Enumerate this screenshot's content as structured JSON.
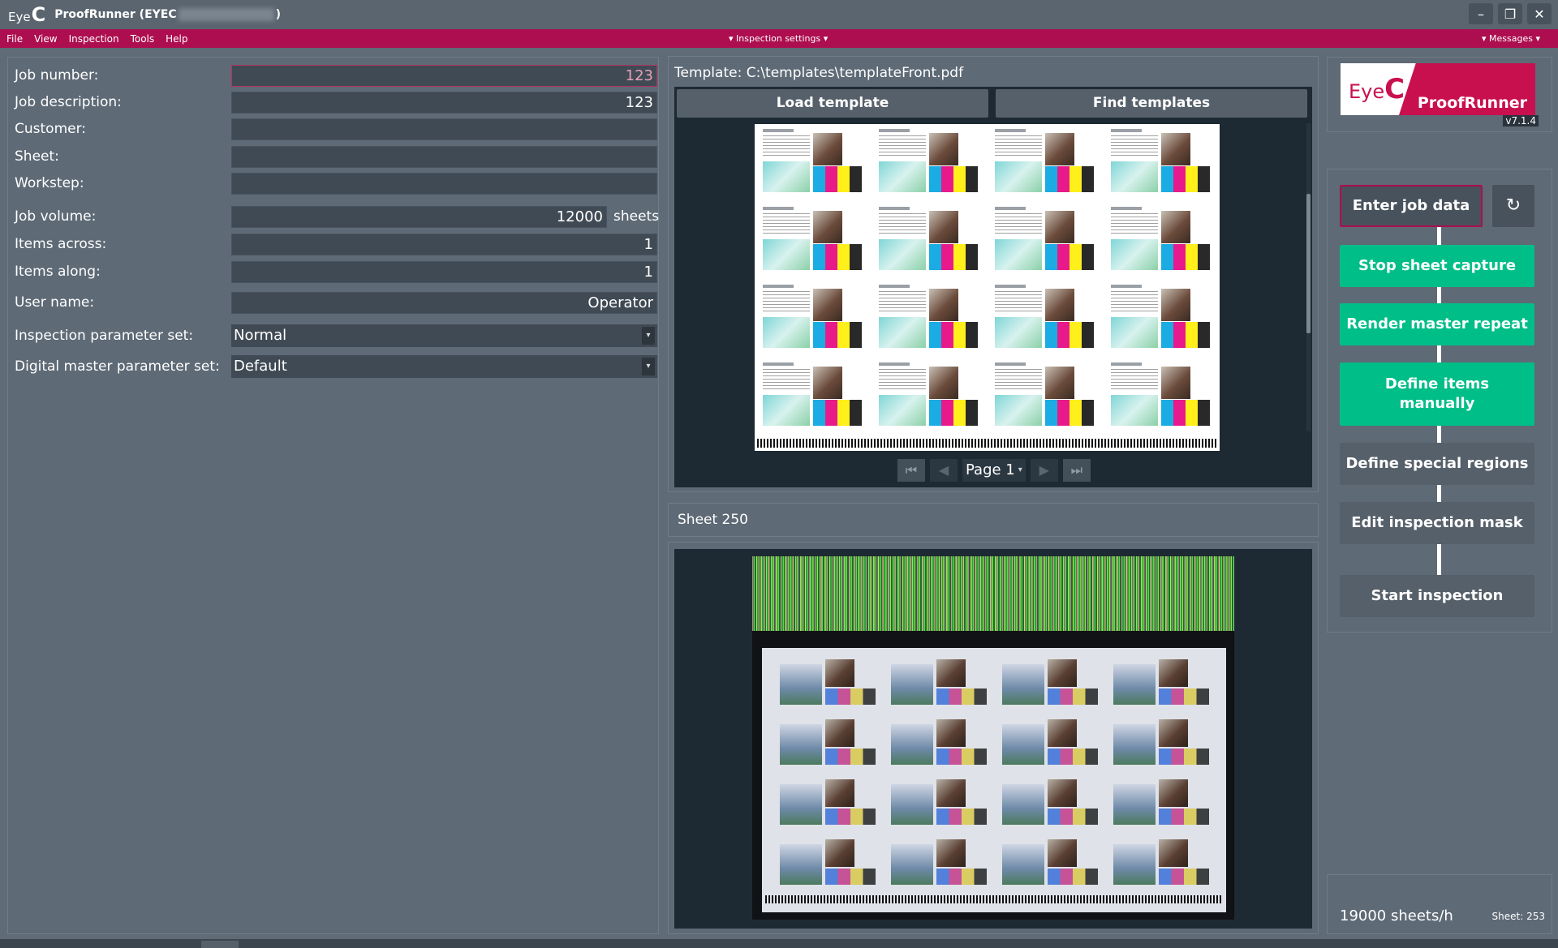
{
  "titlebar": {
    "logo_text": "Eye",
    "logo_c": "C",
    "title_prefix": "ProofRunner  (EYEC",
    "title_suffix": ")",
    "min_icon": "–",
    "restore_icon": "❐",
    "close_icon": "✕"
  },
  "menubar": {
    "items": [
      "File",
      "View",
      "Inspection",
      "Tools",
      "Help"
    ],
    "center": "▾ Inspection settings ▾",
    "right": "▾ Messages ▾"
  },
  "form": {
    "job_number": {
      "label": "Job number:",
      "value": "123"
    },
    "job_description": {
      "label": "Job description:",
      "value": "123"
    },
    "customer": {
      "label": "Customer:",
      "value": ""
    },
    "sheet": {
      "label": "Sheet:",
      "value": ""
    },
    "workstep": {
      "label": "Workstep:",
      "value": ""
    },
    "job_volume": {
      "label": "Job volume:",
      "value": "12000",
      "unit": "sheets"
    },
    "items_across": {
      "label": "Items across:",
      "value": "1"
    },
    "items_along": {
      "label": "Items along:",
      "value": "1"
    },
    "user_name": {
      "label": "User name:",
      "value": "Operator"
    },
    "inspection_param": {
      "label": "Inspection parameter set:",
      "value": "Normal"
    },
    "digital_master_param": {
      "label": "Digital master parameter set:",
      "value": "Default"
    }
  },
  "template": {
    "label": "Template:",
    "path": "C:\\templates\\templateFront.pdf",
    "load_button": "Load template",
    "find_button": "Find templates",
    "page_label": "Page 1"
  },
  "sheet_panel": {
    "title": "Sheet 250"
  },
  "logo": {
    "eye": "Eye",
    "c": "C",
    "product": "ProofRunner",
    "version": "v7.1.4"
  },
  "workflow": {
    "enter_job_data": "Enter job data",
    "refresh_icon": "↻",
    "stop_sheet_capture": "Stop sheet capture",
    "render_master_repeat": "Render master repeat",
    "define_items_manually": "Define items manually",
    "define_special_regions": "Define special regions",
    "edit_inspection_mask": "Edit inspection mask",
    "start_inspection": "Start inspection"
  },
  "status": {
    "rate": "19000 sheets/h",
    "sheet_count": "Sheet:  253"
  },
  "colors": {
    "accent": "#ad0e4f",
    "workflow_green": "#00be88",
    "panel": "#5e6a76",
    "dark": "#1d2a33"
  }
}
